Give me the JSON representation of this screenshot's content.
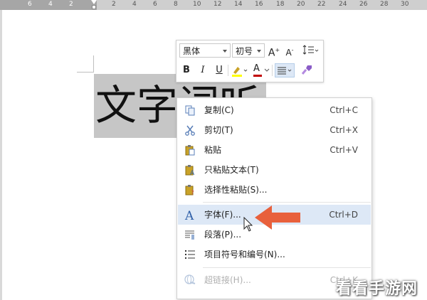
{
  "ruler": {
    "numbers": [
      "6",
      "4",
      "2",
      "2",
      "4",
      "6",
      "8",
      "10",
      "12",
      "14",
      "16",
      "18",
      "20",
      "22",
      "24",
      "26",
      "28",
      "30"
    ]
  },
  "document": {
    "selected_text": "文字词听"
  },
  "mini_toolbar": {
    "font_name": "黑体",
    "font_size": "初号",
    "grow_font": "A",
    "shrink_font": "A",
    "bold": "B",
    "italic": "I",
    "underline": "U",
    "font_color": "A",
    "highlight_color": "#ffff00",
    "font_color_value": "#c00000"
  },
  "context_menu": {
    "items": [
      {
        "label": "复制(C)",
        "shortcut": "Ctrl+C",
        "icon": "copy-icon"
      },
      {
        "label": "剪切(T)",
        "shortcut": "Ctrl+X",
        "icon": "scissors-icon"
      },
      {
        "label": "粘贴",
        "shortcut": "Ctrl+V",
        "icon": "paste-icon"
      },
      {
        "label": "只粘贴文本(T)",
        "shortcut": "",
        "icon": "paste-text-icon"
      },
      {
        "label": "选择性粘贴(S)...",
        "shortcut": "",
        "icon": "paste-special-icon"
      },
      {
        "label": "字体(F)...",
        "shortcut": "Ctrl+D",
        "icon": "font-icon"
      },
      {
        "label": "段落(P)...",
        "shortcut": "",
        "icon": "paragraph-icon"
      },
      {
        "label": "项目符号和编号(N)...",
        "shortcut": "",
        "icon": "bullets-icon"
      },
      {
        "label": "超链接(H)...",
        "shortcut": "Ctrl+K",
        "icon": "hyperlink-icon"
      }
    ]
  },
  "watermark": "看看手游网",
  "colors": {
    "accent": "#2e75d4",
    "highlight_row": "#dde8f6",
    "indicator_arrow": "#e8603c"
  }
}
